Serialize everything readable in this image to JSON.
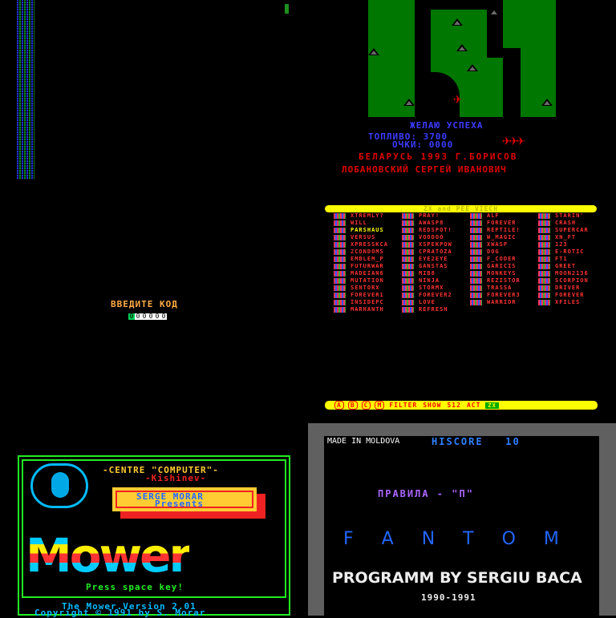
{
  "panel_raid": {
    "wish_text": "ЖЕЛАЮ УСПЕХА",
    "fuel_line": "ТОПЛИВО: 3700",
    "score_line": "ОЧКИ:  0000",
    "credit_line": "БЕЛАРУСЬ 1993   Г.БОРИСОВ",
    "author_line": "ЛОБАНОВСКИЙ СЕРГЕЙ ИВАНОВИЧ",
    "lives_icons": "✈✈✈"
  },
  "panel_code": {
    "label": "ВВЕДИТЕ КОД",
    "code_cells": [
      "0",
      "0",
      "0",
      "0",
      "0"
    ]
  },
  "panel_menu": {
    "header": "ZX and PEE VIECH",
    "columns": [
      {
        "items": [
          {
            "label": "XTREMLY?",
            "color": "#ff3333"
          },
          {
            "label": "WILL",
            "color": "#ff3333"
          },
          {
            "label": "PARSHAUS",
            "color": "#ffff00"
          },
          {
            "label": "VERSUS",
            "color": "#ff3333"
          },
          {
            "label": "XPRESSKCA",
            "color": "#ff3333"
          },
          {
            "label": "2CONDOMS",
            "color": "#ff3333"
          },
          {
            "label": "EMBLEM_P",
            "color": "#ff3333"
          },
          {
            "label": "FUTURWAR",
            "color": "#ff3333"
          },
          {
            "label": "MADEIAN6",
            "color": "#ff3333"
          },
          {
            "label": "MUTATION",
            "color": "#ff3333"
          },
          {
            "label": "SENTORX",
            "color": "#ff3333"
          },
          {
            "label": "FOREVER1",
            "color": "#ff3333"
          },
          {
            "label": "INSIDEPC",
            "color": "#ff3333"
          },
          {
            "label": "MARHANTH",
            "color": "#ff3333"
          }
        ]
      },
      {
        "items": [
          {
            "label": "PRAY!",
            "color": "#ff3333"
          },
          {
            "label": "AWASP8",
            "color": "#ff3333"
          },
          {
            "label": "REDSPOT!",
            "color": "#ff3333"
          },
          {
            "label": "VOODOO",
            "color": "#ff3333"
          },
          {
            "label": "XSPEKPOW",
            "color": "#ff3333"
          },
          {
            "label": "CPRATOZA",
            "color": "#ff3333"
          },
          {
            "label": "EYE2EYE",
            "color": "#ff3333"
          },
          {
            "label": "GANSTAS",
            "color": "#ff3333"
          },
          {
            "label": "MIB8",
            "color": "#ff3333"
          },
          {
            "label": "NINJA",
            "color": "#ff3333"
          },
          {
            "label": "STORMX",
            "color": "#ff3333"
          },
          {
            "label": "FOREVER2",
            "color": "#ff3333"
          },
          {
            "label": "LOVE",
            "color": "#ff3333"
          },
          {
            "label": "REFRESH",
            "color": "#ff3333"
          }
        ]
      },
      {
        "items": [
          {
            "label": "ALF",
            "color": "#ff3333"
          },
          {
            "label": "FOREVER",
            "color": "#ff3333"
          },
          {
            "label": "REPTILE!",
            "color": "#ff3333"
          },
          {
            "label": "W_MAGIC",
            "color": "#ff3333"
          },
          {
            "label": "XWASP",
            "color": "#ff3333"
          },
          {
            "label": "DOG",
            "color": "#ff3333"
          },
          {
            "label": "F_CODER",
            "color": "#ff3333"
          },
          {
            "label": "GARICIS",
            "color": "#ff3333"
          },
          {
            "label": "MONKEYS",
            "color": "#ff3333"
          },
          {
            "label": "REZISTOR",
            "color": "#ff3333"
          },
          {
            "label": "TRASSA",
            "color": "#ff3333"
          },
          {
            "label": "FOREVER3",
            "color": "#ff3333"
          },
          {
            "label": "WARRIOR",
            "color": "#ff3333"
          }
        ]
      },
      {
        "items": [
          {
            "label": "STARIN'",
            "color": "#ff3333"
          },
          {
            "label": "CRASH",
            "color": "#ff3333"
          },
          {
            "label": "SUPERCAR",
            "color": "#ff3333"
          },
          {
            "label": "XN_FT",
            "color": "#ff3333"
          },
          {
            "label": "123",
            "color": "#ff3333"
          },
          {
            "label": "E-ROTIC",
            "color": "#ff3333"
          },
          {
            "label": "FT1",
            "color": "#ff3333"
          },
          {
            "label": "GREET",
            "color": "#ff3333"
          },
          {
            "label": "MOON2136",
            "color": "#ff3333"
          },
          {
            "label": "SCORPION",
            "color": "#ff3333"
          },
          {
            "label": "DRIVER",
            "color": "#ff3333"
          },
          {
            "label": "FOREVER",
            "color": "#ff3333"
          },
          {
            "label": "XFILES",
            "color": "#ff3333"
          }
        ]
      }
    ],
    "footer_buttons": [
      "A",
      "B",
      "C",
      "M",
      "FILTER",
      "SHOW",
      "512",
      "ACT"
    ],
    "footer_tag": "ZX"
  },
  "panel_mower": {
    "centre": "-CENTRE \"COMPUTER\"-",
    "city": "-Kishinev-",
    "presents_1": "SERGE MORAR",
    "presents_2": "Presents",
    "title": "Mower",
    "prompt": "Press space key!",
    "version": "The Mower.Version 2.01",
    "copyright": "Copyright © 1991 by S. Morar"
  },
  "panel_fantom": {
    "made_in": "MADE IN MOLDOVA",
    "hiscore_label": "HISCORE",
    "hiscore_value": "10",
    "rules": "ПРАВИЛА - \"П\"",
    "title": "F A N T O M",
    "program_by": "PROGRAMM BY SERGIU BACA",
    "years": "1990-1991"
  }
}
